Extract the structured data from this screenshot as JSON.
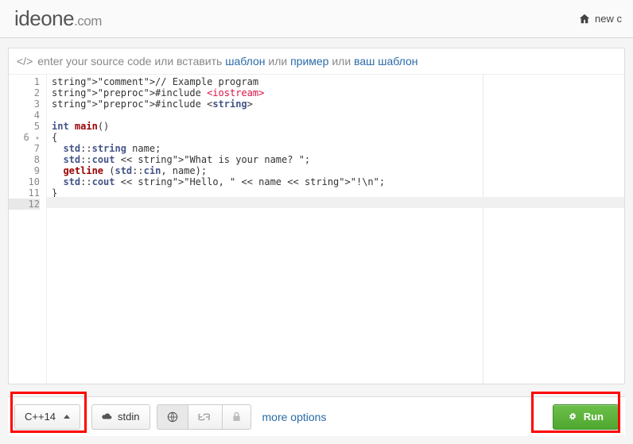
{
  "header": {
    "logo_bold": "ideone",
    "logo_com": ".com",
    "nav_new": "new c"
  },
  "prompt": {
    "lead": "enter your source code или вставить ",
    "link_template": "шаблон",
    "mid1": " или ",
    "link_example": "пример",
    "mid2": " или ",
    "link_yourtemplate": "ваш шаблон"
  },
  "code": {
    "line_numbers": [
      "1",
      "2",
      "3",
      "4",
      "5",
      "6",
      "7",
      "8",
      "9",
      "10",
      "11",
      "12"
    ],
    "fold_line": "6",
    "lines_plain": [
      "// Example program",
      "#include <iostream>",
      "#include <string>",
      "",
      "int main()",
      "{",
      "  std::string name;",
      "  std::cout << \"What is your name? \";",
      "  getline (std::cin, name);",
      "  std::cout << \"Hello, \" << name << \"!\\n\";",
      "}",
      ""
    ]
  },
  "toolbar": {
    "language": "C++14",
    "stdin": "stdin",
    "more": "more options",
    "run": "Run"
  }
}
